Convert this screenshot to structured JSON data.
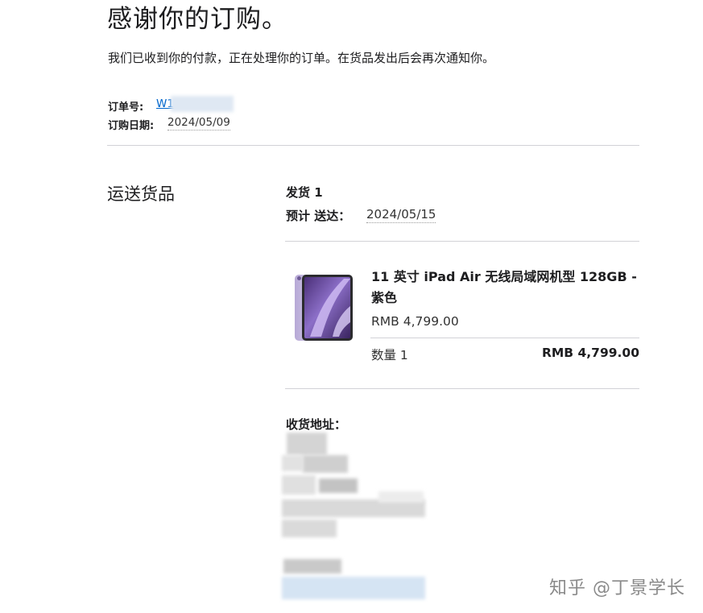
{
  "header": {
    "title": "感谢你的订购。",
    "subtitle": "我们已收到你的付款，正在处理你的订单。在货品发出后会再次通知你。"
  },
  "order": {
    "number_label": "订单号:",
    "number_value": "W1",
    "date_label": "订购日期:",
    "date_value": "2024/05/09"
  },
  "shipping": {
    "section_title": "运送货品",
    "shipment_label": "发货 1",
    "eta_label": "预计 送达：",
    "eta_value": "2024/05/15"
  },
  "product": {
    "name": "11 英寸 iPad Air 无线局域网机型 128GB - 紫色",
    "price": "RMB 4,799.00",
    "quantity": "数量 1",
    "total": "RMB 4,799.00",
    "image_icon": "ipad-air-purple",
    "accent_color": "#9b87c9"
  },
  "address": {
    "label": "收货地址："
  },
  "watermark": {
    "text": "知乎 @丁景学长"
  }
}
